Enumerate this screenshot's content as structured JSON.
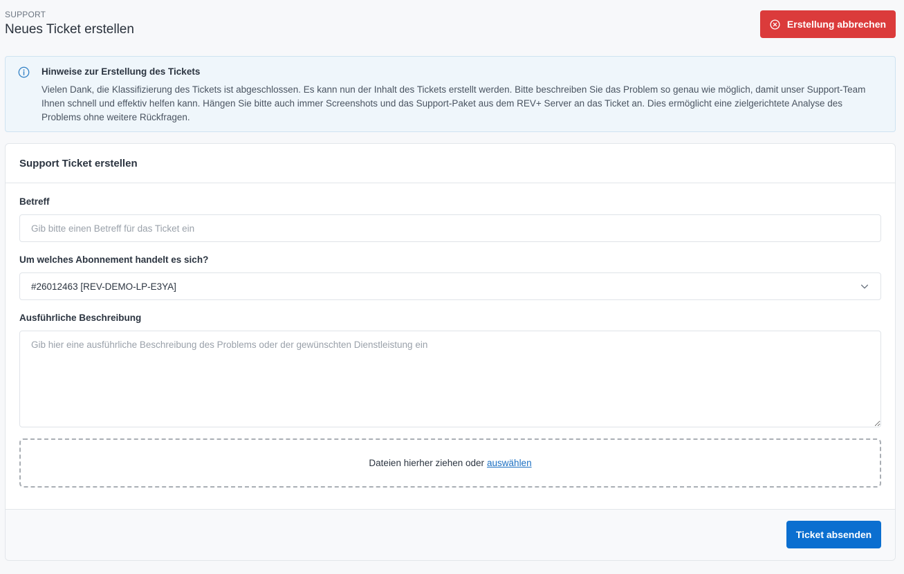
{
  "header": {
    "eyebrow": "SUPPORT",
    "title": "Neues Ticket erstellen",
    "cancel_label": "Erstellung abbrechen"
  },
  "info": {
    "title": "Hinweise zur Erstellung des Tickets",
    "text": "Vielen Dank, die Klassifizierung des Tickets ist abgeschlossen. Es kann nun der Inhalt des Tickets erstellt werden. Bitte beschreiben Sie das Problem so genau wie möglich, damit unser Support-Team Ihnen schnell und effektiv helfen kann. Hängen Sie bitte auch immer Screenshots und das Support-Paket aus dem REV+ Server an das Ticket an. Dies ermöglicht eine zielgerichtete Analyse des Problems ohne weitere Rückfragen."
  },
  "form": {
    "card_title": "Support Ticket erstellen",
    "subject_label": "Betreff",
    "subject_value": "",
    "subject_placeholder": "Gib bitte einen Betreff für das Ticket ein",
    "subscription_label": "Um welches Abonnement handelt es sich?",
    "subscription_value": "#26012463 [REV-DEMO-LP-E3YA]",
    "description_label": "Ausführliche Beschreibung",
    "description_value": "",
    "description_placeholder": "Gib hier eine ausführliche Beschreibung des Problems oder der gewünschten Dienstleistung ein",
    "dropzone_text": "Dateien hierher ziehen oder",
    "dropzone_link": "auswählen",
    "submit_label": "Ticket absenden"
  },
  "colors": {
    "danger": "#db3b3b",
    "primary": "#0b6fd0",
    "info_bg": "#eff6fb",
    "info_icon": "#2f7fc4"
  },
  "icons": {
    "cancel": "x-circle-icon",
    "info": "info-circle-icon",
    "select": "chevron-down-icon"
  }
}
